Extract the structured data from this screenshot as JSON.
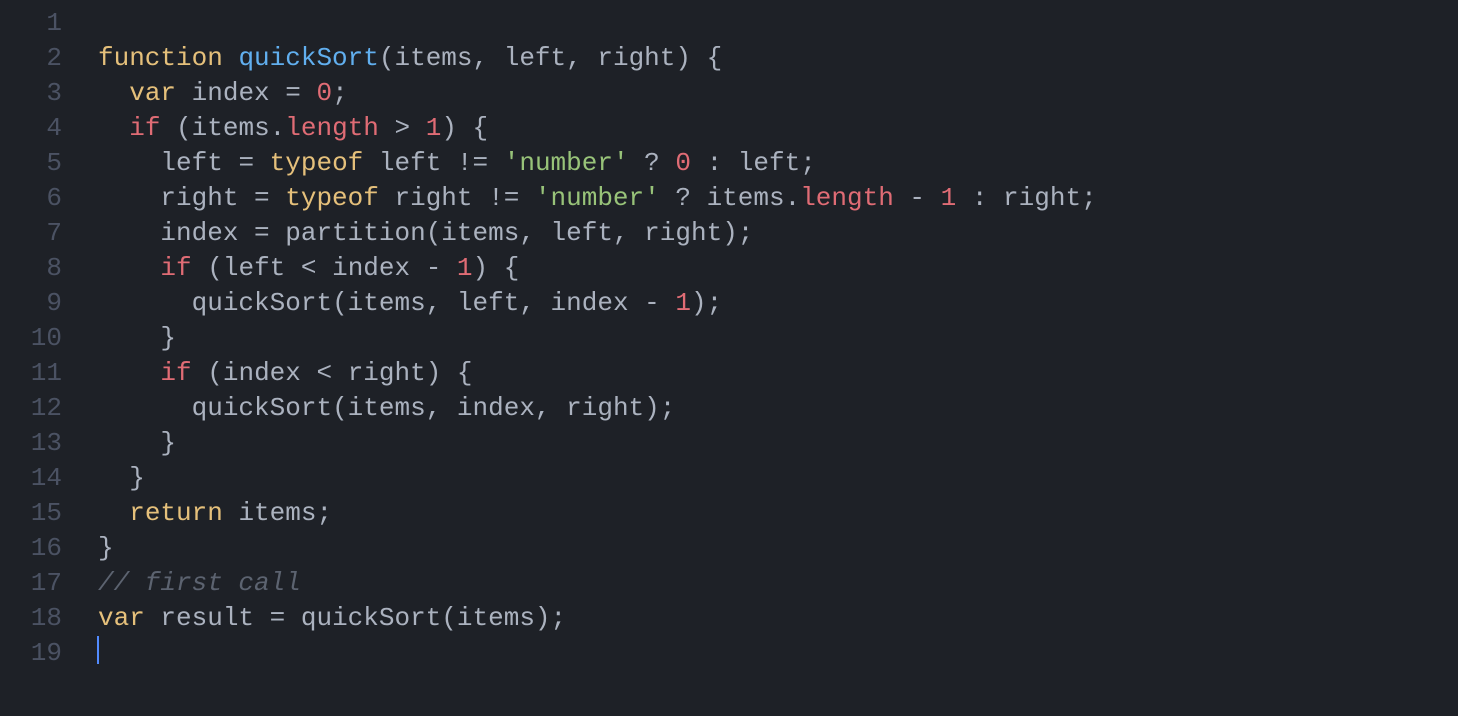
{
  "editor": {
    "language": "javascript",
    "lineNumbers": [
      "1",
      "2",
      "3",
      "4",
      "5",
      "6",
      "7",
      "8",
      "9",
      "10",
      "11",
      "12",
      "13",
      "14",
      "15",
      "16",
      "17",
      "18",
      "19"
    ],
    "cursorLine": 19,
    "lines": [
      [],
      [
        {
          "t": "function",
          "c": "tok-keyword"
        },
        {
          "t": " ",
          "c": "tok-op"
        },
        {
          "t": "quickSort",
          "c": "tok-funcname"
        },
        {
          "t": "(",
          "c": "tok-punct"
        },
        {
          "t": "items",
          "c": "tok-param"
        },
        {
          "t": ", ",
          "c": "tok-punct"
        },
        {
          "t": "left",
          "c": "tok-param"
        },
        {
          "t": ", ",
          "c": "tok-punct"
        },
        {
          "t": "right",
          "c": "tok-param"
        },
        {
          "t": ") {",
          "c": "tok-punct"
        }
      ],
      [
        {
          "t": "  ",
          "c": "tok-op"
        },
        {
          "t": "var",
          "c": "tok-keyword"
        },
        {
          "t": " ",
          "c": "tok-op"
        },
        {
          "t": "index",
          "c": "tok-ident"
        },
        {
          "t": " = ",
          "c": "tok-assign"
        },
        {
          "t": "0",
          "c": "tok-number"
        },
        {
          "t": ";",
          "c": "tok-punct"
        }
      ],
      [
        {
          "t": "  ",
          "c": "tok-op"
        },
        {
          "t": "if",
          "c": "tok-if"
        },
        {
          "t": " (",
          "c": "tok-punct"
        },
        {
          "t": "items",
          "c": "tok-ident"
        },
        {
          "t": ".",
          "c": "tok-punct"
        },
        {
          "t": "length",
          "c": "tok-prop"
        },
        {
          "t": " > ",
          "c": "tok-op"
        },
        {
          "t": "1",
          "c": "tok-number"
        },
        {
          "t": ") {",
          "c": "tok-punct"
        }
      ],
      [
        {
          "t": "    ",
          "c": "tok-op"
        },
        {
          "t": "left",
          "c": "tok-ident"
        },
        {
          "t": " = ",
          "c": "tok-assign"
        },
        {
          "t": "typeof",
          "c": "tok-keyword"
        },
        {
          "t": " ",
          "c": "tok-op"
        },
        {
          "t": "left",
          "c": "tok-ident"
        },
        {
          "t": " != ",
          "c": "tok-op"
        },
        {
          "t": "'number'",
          "c": "tok-string"
        },
        {
          "t": " ? ",
          "c": "tok-op"
        },
        {
          "t": "0",
          "c": "tok-number"
        },
        {
          "t": " : ",
          "c": "tok-op"
        },
        {
          "t": "left",
          "c": "tok-ident"
        },
        {
          "t": ";",
          "c": "tok-punct"
        }
      ],
      [
        {
          "t": "    ",
          "c": "tok-op"
        },
        {
          "t": "right",
          "c": "tok-ident"
        },
        {
          "t": " = ",
          "c": "tok-assign"
        },
        {
          "t": "typeof",
          "c": "tok-keyword"
        },
        {
          "t": " ",
          "c": "tok-op"
        },
        {
          "t": "right",
          "c": "tok-ident"
        },
        {
          "t": " != ",
          "c": "tok-op"
        },
        {
          "t": "'number'",
          "c": "tok-string"
        },
        {
          "t": " ? ",
          "c": "tok-op"
        },
        {
          "t": "items",
          "c": "tok-ident"
        },
        {
          "t": ".",
          "c": "tok-punct"
        },
        {
          "t": "length",
          "c": "tok-prop"
        },
        {
          "t": " - ",
          "c": "tok-op"
        },
        {
          "t": "1",
          "c": "tok-number"
        },
        {
          "t": " : ",
          "c": "tok-op"
        },
        {
          "t": "right",
          "c": "tok-ident"
        },
        {
          "t": ";",
          "c": "tok-punct"
        }
      ],
      [
        {
          "t": "    ",
          "c": "tok-op"
        },
        {
          "t": "index",
          "c": "tok-ident"
        },
        {
          "t": " = ",
          "c": "tok-assign"
        },
        {
          "t": "partition",
          "c": "tok-call"
        },
        {
          "t": "(",
          "c": "tok-punct"
        },
        {
          "t": "items",
          "c": "tok-ident"
        },
        {
          "t": ", ",
          "c": "tok-punct"
        },
        {
          "t": "left",
          "c": "tok-ident"
        },
        {
          "t": ", ",
          "c": "tok-punct"
        },
        {
          "t": "right",
          "c": "tok-ident"
        },
        {
          "t": ");",
          "c": "tok-punct"
        }
      ],
      [
        {
          "t": "    ",
          "c": "tok-op"
        },
        {
          "t": "if",
          "c": "tok-if"
        },
        {
          "t": " (",
          "c": "tok-punct"
        },
        {
          "t": "left",
          "c": "tok-ident"
        },
        {
          "t": " < ",
          "c": "tok-op"
        },
        {
          "t": "index",
          "c": "tok-ident"
        },
        {
          "t": " - ",
          "c": "tok-op"
        },
        {
          "t": "1",
          "c": "tok-number"
        },
        {
          "t": ") {",
          "c": "tok-punct"
        }
      ],
      [
        {
          "t": "      ",
          "c": "tok-op"
        },
        {
          "t": "quickSort",
          "c": "tok-call"
        },
        {
          "t": "(",
          "c": "tok-punct"
        },
        {
          "t": "items",
          "c": "tok-ident"
        },
        {
          "t": ", ",
          "c": "tok-punct"
        },
        {
          "t": "left",
          "c": "tok-ident"
        },
        {
          "t": ", ",
          "c": "tok-punct"
        },
        {
          "t": "index",
          "c": "tok-ident"
        },
        {
          "t": " - ",
          "c": "tok-op"
        },
        {
          "t": "1",
          "c": "tok-number"
        },
        {
          "t": ");",
          "c": "tok-punct"
        }
      ],
      [
        {
          "t": "    }",
          "c": "tok-punct"
        }
      ],
      [
        {
          "t": "    ",
          "c": "tok-op"
        },
        {
          "t": "if",
          "c": "tok-if"
        },
        {
          "t": " (",
          "c": "tok-punct"
        },
        {
          "t": "index",
          "c": "tok-ident"
        },
        {
          "t": " < ",
          "c": "tok-op"
        },
        {
          "t": "right",
          "c": "tok-ident"
        },
        {
          "t": ") {",
          "c": "tok-punct"
        }
      ],
      [
        {
          "t": "      ",
          "c": "tok-op"
        },
        {
          "t": "quickSort",
          "c": "tok-call"
        },
        {
          "t": "(",
          "c": "tok-punct"
        },
        {
          "t": "items",
          "c": "tok-ident"
        },
        {
          "t": ", ",
          "c": "tok-punct"
        },
        {
          "t": "index",
          "c": "tok-ident"
        },
        {
          "t": ", ",
          "c": "tok-punct"
        },
        {
          "t": "right",
          "c": "tok-ident"
        },
        {
          "t": ");",
          "c": "tok-punct"
        }
      ],
      [
        {
          "t": "    }",
          "c": "tok-punct"
        }
      ],
      [
        {
          "t": "  }",
          "c": "tok-punct"
        }
      ],
      [
        {
          "t": "  ",
          "c": "tok-op"
        },
        {
          "t": "return",
          "c": "tok-keyword"
        },
        {
          "t": " ",
          "c": "tok-op"
        },
        {
          "t": "items",
          "c": "tok-ident"
        },
        {
          "t": ";",
          "c": "tok-punct"
        }
      ],
      [
        {
          "t": "}",
          "c": "tok-punct"
        }
      ],
      [
        {
          "t": "// first call",
          "c": "tok-comment"
        }
      ],
      [
        {
          "t": "var",
          "c": "tok-keyword"
        },
        {
          "t": " ",
          "c": "tok-op"
        },
        {
          "t": "result",
          "c": "tok-ident"
        },
        {
          "t": " = ",
          "c": "tok-assign"
        },
        {
          "t": "quickSort",
          "c": "tok-call"
        },
        {
          "t": "(",
          "c": "tok-punct"
        },
        {
          "t": "items",
          "c": "tok-ident"
        },
        {
          "t": ");",
          "c": "tok-punct"
        }
      ],
      []
    ]
  }
}
